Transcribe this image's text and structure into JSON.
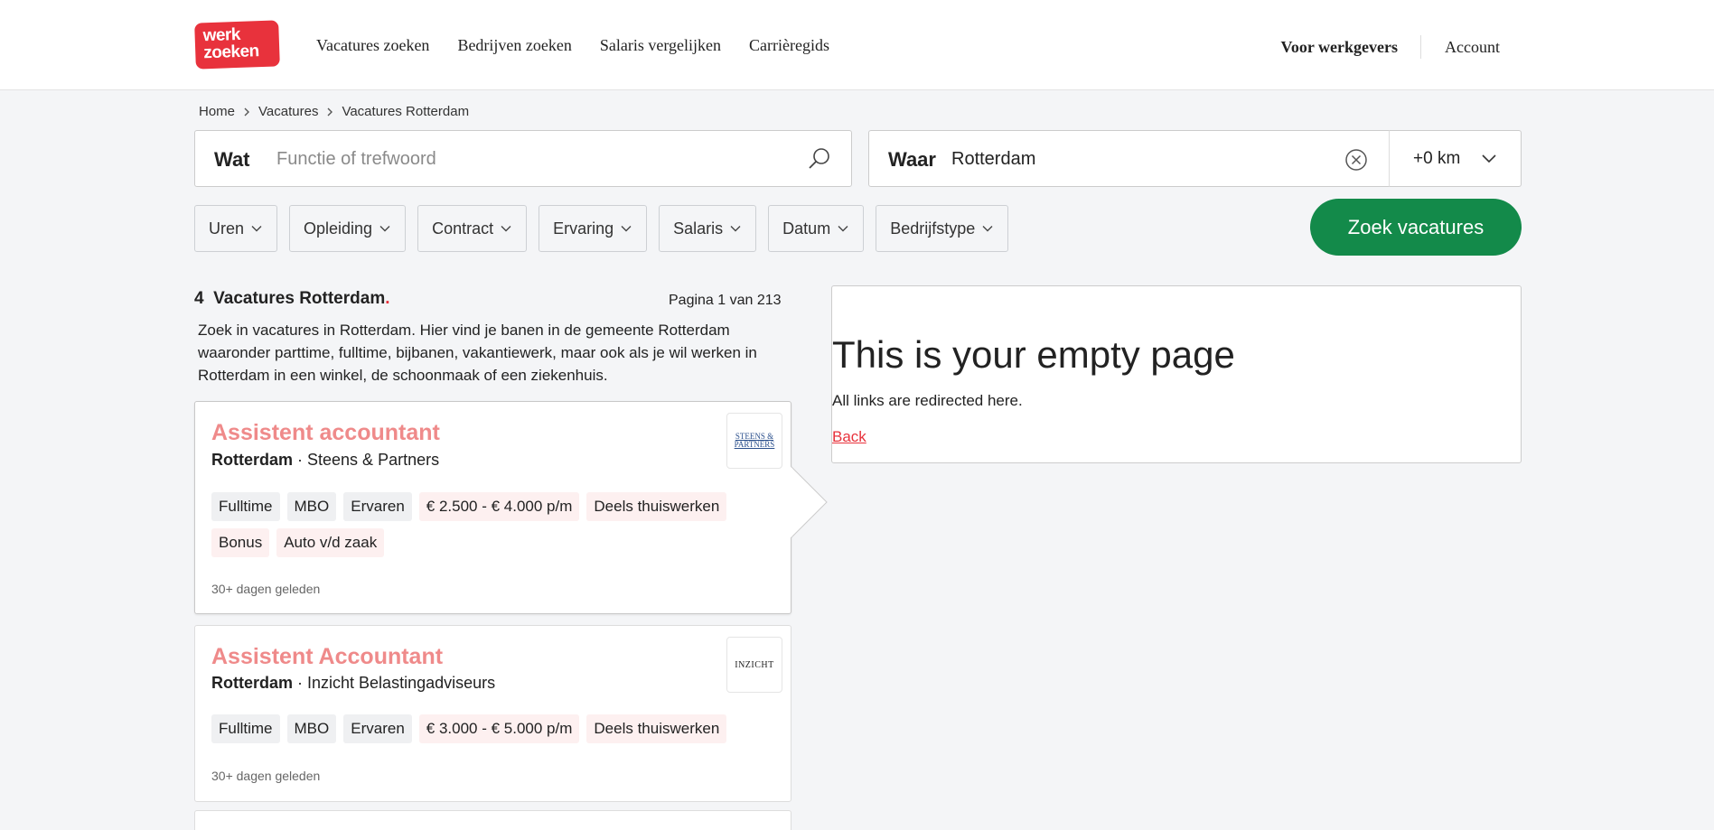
{
  "header": {
    "logo_line1": "werk",
    "logo_line2": "zoeken",
    "nav": [
      "Vacatures zoeken",
      "Bedrijven zoeken",
      "Salaris vergelijken",
      "Carrièregids"
    ],
    "employers": "Voor werkgevers",
    "account": "Account"
  },
  "breadcrumb": [
    "Home",
    "Vacatures",
    "Vacatures Rotterdam"
  ],
  "search": {
    "wat_label": "Wat",
    "wat_placeholder": "Functie of trefwoord",
    "waar_label": "Waar",
    "waar_value": "Rotterdam",
    "radius": "+0 km"
  },
  "filters": [
    "Uren",
    "Opleiding",
    "Contract",
    "Ervaring",
    "Salaris",
    "Datum",
    "Bedrijfstype"
  ],
  "search_button": "Zoek vacatures",
  "results": {
    "count": "4",
    "heading": "Vacatures Rotterdam",
    "page_info": "Pagina 1 van 213",
    "intro": "Zoek in vacatures in Rotterdam. Hier vind je banen in de gemeente Rotterdam waaronder parttime, fulltime, bijbanen, vakantiewerk, maar ook als je wil werken in Rotterdam in een winkel, de schoonmaak of een ziekenhuis."
  },
  "jobs": [
    {
      "title": "Assistent accountant",
      "city": "Rotterdam",
      "company": "Steens & Partners",
      "logo_text": "STEENS & PARTNERS",
      "tags_grey": [
        "Fulltime",
        "MBO",
        "Ervaren"
      ],
      "tags_pink": [
        "€ 2.500 - € 4.000 p/m",
        "Deels thuiswerken",
        "Bonus",
        "Auto v/d zaak"
      ],
      "posted": "30+ dagen geleden"
    },
    {
      "title": "Assistent Accountant",
      "city": "Rotterdam",
      "company": "Inzicht Belastingadviseurs",
      "logo_text": "INZICHT",
      "tags_grey": [
        "Fulltime",
        "MBO",
        "Ervaren"
      ],
      "tags_pink": [
        "€ 3.000 - € 5.000 p/m",
        "Deels thuiswerken"
      ],
      "posted": "30+ dagen geleden"
    }
  ],
  "empty_panel": {
    "title": "This is your empty page",
    "text": "All links are redirected here.",
    "back": "Back"
  },
  "colors": {
    "brand_red": "#e8323c",
    "title_pink": "#ef8a8a",
    "button_green": "#138a4a"
  }
}
